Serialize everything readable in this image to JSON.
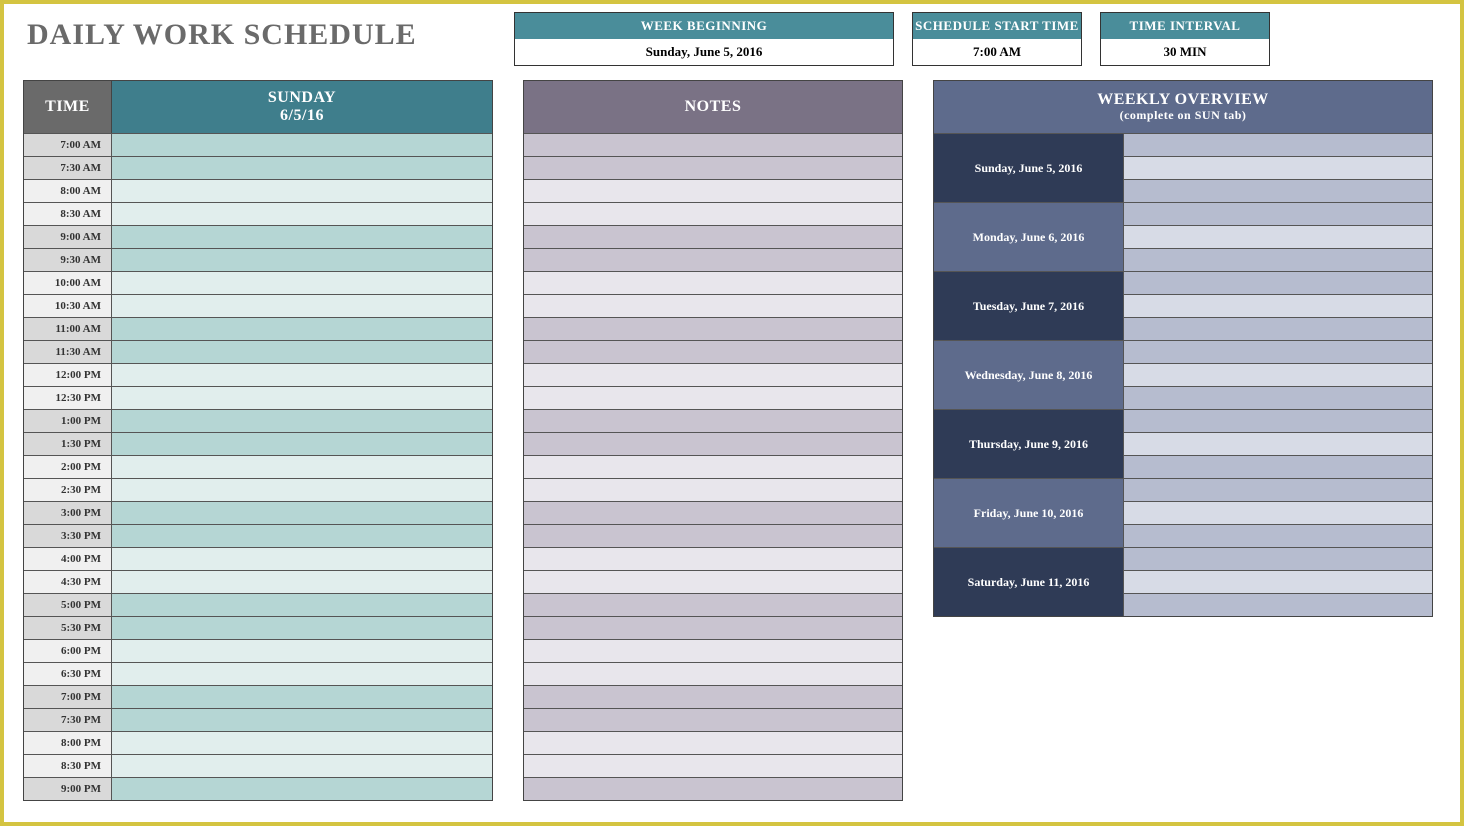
{
  "title": "DAILY WORK SCHEDULE",
  "meta": {
    "week_label": "WEEK BEGINNING",
    "week_value": "Sunday, June 5, 2016",
    "start_label": "SCHEDULE START TIME",
    "start_value": "7:00 AM",
    "interval_label": "TIME INTERVAL",
    "interval_value": "30 MIN"
  },
  "schedule": {
    "time_header": "TIME",
    "day_name": "SUNDAY",
    "day_date": "6/5/16",
    "times": [
      "7:00 AM",
      "7:30 AM",
      "8:00 AM",
      "8:30 AM",
      "9:00 AM",
      "9:30 AM",
      "10:00 AM",
      "10:30 AM",
      "11:00 AM",
      "11:30 AM",
      "12:00 PM",
      "12:30 PM",
      "1:00 PM",
      "1:30 PM",
      "2:00 PM",
      "2:30 PM",
      "3:00 PM",
      "3:30 PM",
      "4:00 PM",
      "4:30 PM",
      "5:00 PM",
      "5:30 PM",
      "6:00 PM",
      "6:30 PM",
      "7:00 PM",
      "7:30 PM",
      "8:00 PM",
      "8:30 PM",
      "9:00 PM"
    ]
  },
  "notes": {
    "header": "NOTES",
    "row_count": 29
  },
  "overview": {
    "header": "WEEKLY OVERVIEW",
    "subheader": "(complete on SUN tab)",
    "days": [
      "Sunday, June 5, 2016",
      "Monday, June 6, 2016",
      "Tuesday, June 7, 2016",
      "Wednesday, June 8, 2016",
      "Thursday, June 9, 2016",
      "Friday, June 10, 2016",
      "Saturday, June 11, 2016"
    ]
  }
}
